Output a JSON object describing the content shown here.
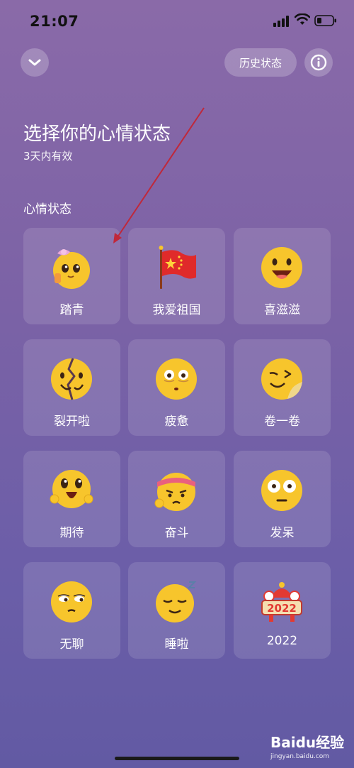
{
  "status_bar": {
    "time": "21:07"
  },
  "header": {
    "history_label": "历史状态"
  },
  "title": "选择你的心情状态",
  "subtitle": "3天内有效",
  "section_label": "心情状态",
  "moods": [
    {
      "label": "踏青",
      "icon": "spring-outing-emoji-icon"
    },
    {
      "label": "我爱祖国",
      "icon": "china-flag-icon"
    },
    {
      "label": "喜滋滋",
      "icon": "happy-emoji-icon"
    },
    {
      "label": "裂开啦",
      "icon": "cracked-emoji-icon"
    },
    {
      "label": "疲惫",
      "icon": "tired-emoji-icon"
    },
    {
      "label": "卷一卷",
      "icon": "curl-emoji-icon"
    },
    {
      "label": "期待",
      "icon": "expectant-emoji-icon"
    },
    {
      "label": "奋斗",
      "icon": "striving-emoji-icon"
    },
    {
      "label": "发呆",
      "icon": "dazed-emoji-icon"
    },
    {
      "label": "无聊",
      "icon": "bored-emoji-icon"
    },
    {
      "label": "睡啦",
      "icon": "sleeping-emoji-icon"
    },
    {
      "label": "2022",
      "icon": "lion-2022-icon"
    }
  ],
  "watermark": {
    "brand": "Baidu经验",
    "domain": "jingyan.baidu.com"
  },
  "colors": {
    "background_top": "#8a6aa8",
    "background_bottom": "#625aa3",
    "emoji_yellow": "#f7c52c",
    "arrow": "#c0283a"
  }
}
